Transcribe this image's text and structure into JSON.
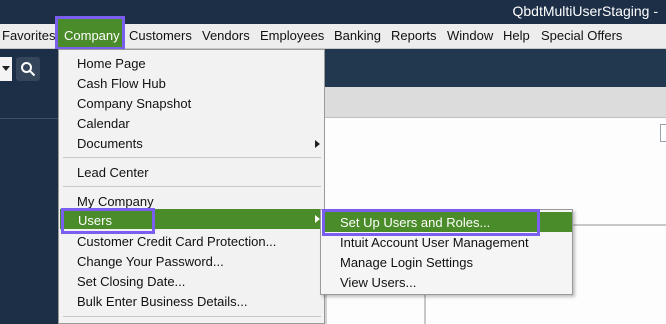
{
  "window": {
    "title": "QbdtMultiUserStaging -"
  },
  "menubar": {
    "items": [
      "Favorites",
      "Company",
      "Customers",
      "Vendors",
      "Employees",
      "Banking",
      "Reports",
      "Window",
      "Help",
      "Special Offers"
    ]
  },
  "company_menu": {
    "items": [
      "Home Page",
      "Cash Flow Hub",
      "Company Snapshot",
      "Calendar",
      "Documents",
      "Lead Center",
      "My Company",
      "Users",
      "Customer Credit Card Protection...",
      "Change Your Password...",
      "Set Closing Date...",
      "Bulk Enter Business Details..."
    ]
  },
  "users_submenu": {
    "items": [
      "Set Up Users and Roles...",
      "Intuit Account User Management",
      "Manage Login Settings",
      "View Users..."
    ]
  },
  "colors": {
    "highlight_green": "#4b8c2a",
    "annotation_purple": "#7a5ef0",
    "dark_panel": "#1c2f46"
  },
  "icons": {
    "search": "search-icon",
    "submenu_arrow": "chevron-right-icon",
    "dropdown": "chevron-down-icon"
  }
}
